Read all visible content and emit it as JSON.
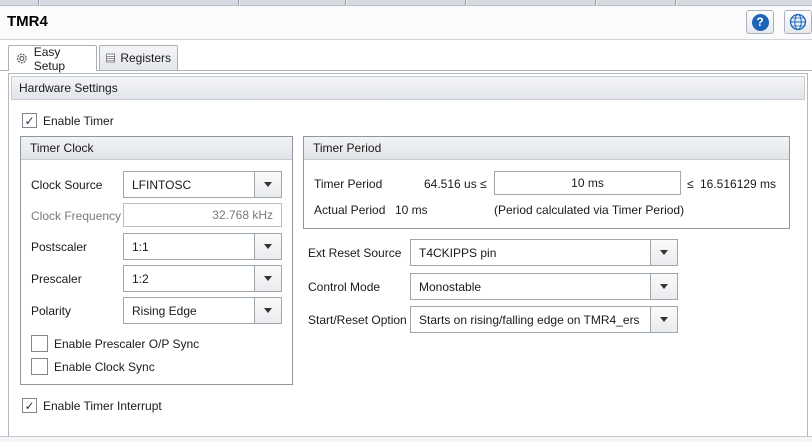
{
  "window": {
    "title": "TMR4"
  },
  "tabs": [
    {
      "label": "Easy Setup",
      "icon": "gear-icon",
      "active": true
    },
    {
      "label": "Registers",
      "icon": "registers-icon",
      "active": false
    }
  ],
  "hardware": {
    "title": "Hardware Settings",
    "enable_timer": {
      "label": "Enable Timer",
      "checked": true
    },
    "timer_clock": {
      "title": "Timer Clock",
      "clock_source": {
        "label": "Clock Source",
        "value": "LFINTOSC"
      },
      "clock_frequency": {
        "label": "Clock Frequency",
        "value": "32.768 kHz"
      },
      "postscaler": {
        "label": "Postscaler",
        "value": "1:1"
      },
      "prescaler": {
        "label": "Prescaler",
        "value": "1:2"
      },
      "polarity": {
        "label": "Polarity",
        "value": "Rising Edge"
      },
      "prescaler_sync": {
        "label": "Enable Prescaler O/P Sync",
        "checked": false
      },
      "clock_sync": {
        "label": "Enable Clock Sync",
        "checked": false
      }
    },
    "timer_period": {
      "title": "Timer Period",
      "period_label": "Timer Period",
      "min": "64.516 us",
      "le1": "≤",
      "value": "10 ms",
      "le2": "≤",
      "max": "16.516129 ms",
      "actual_label": "Actual Period",
      "actual_value": "10 ms",
      "note": "(Period calculated via Timer Period)"
    },
    "ext_reset_source": {
      "label": "Ext Reset Source",
      "value": "T4CKIPPS pin"
    },
    "control_mode": {
      "label": "Control Mode",
      "value": "Monostable"
    },
    "start_reset": {
      "label": "Start/Reset Option",
      "value": "Starts on rising/falling edge on TMR4_ers"
    },
    "enable_interrupt": {
      "label": "Enable Timer Interrupt",
      "checked": true
    }
  },
  "colors": {
    "help_blue": "#1d63b8",
    "border": "#8f969e",
    "header_bg": "#e8ebef"
  }
}
